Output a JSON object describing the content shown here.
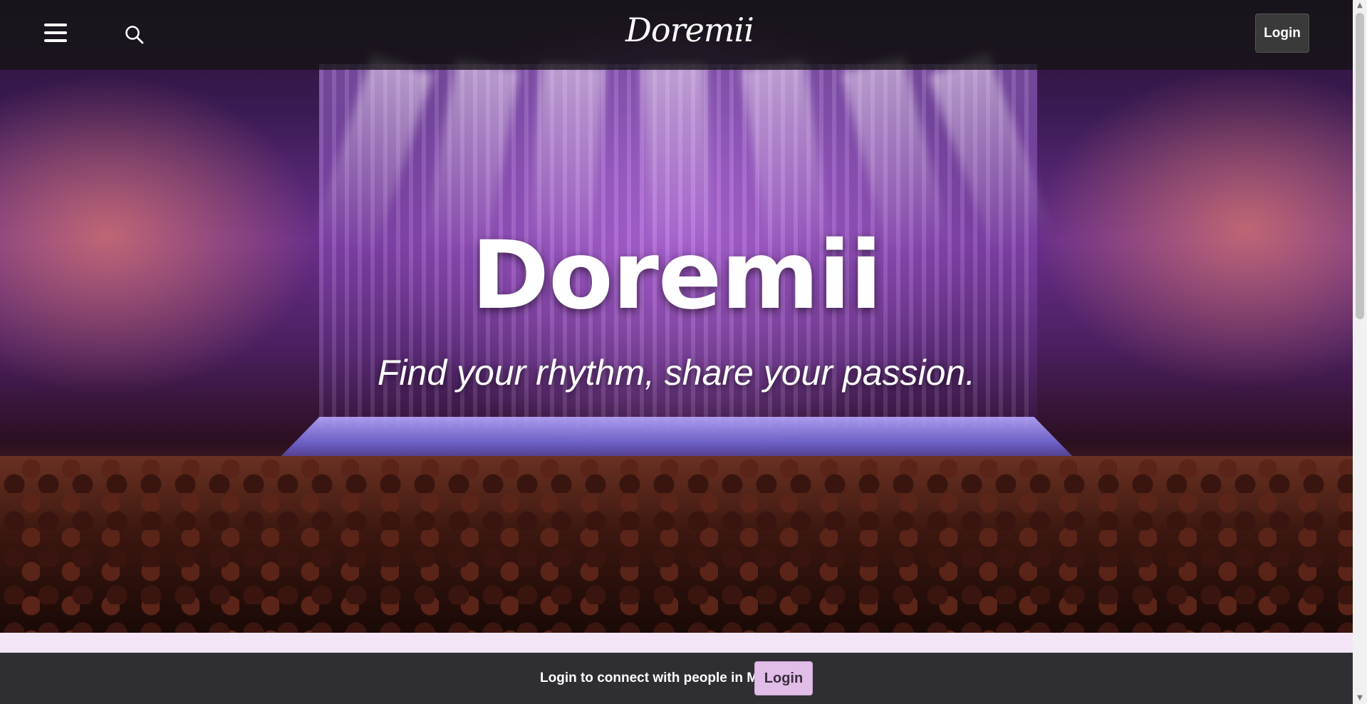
{
  "header": {
    "logo_text": "Doremii",
    "login_label": "Login"
  },
  "hero": {
    "title": "Doremii",
    "subtitle": "Find your rhythm, share your passion."
  },
  "banner": {
    "text": "Login to connect with people in MSN",
    "login_label": "Login"
  },
  "colors": {
    "header_bg": "#141414",
    "banner_bg": "#2f2f33",
    "accent_lavender": "#e1bee7",
    "strip_bg": "#f3e5f5"
  },
  "icons": {
    "menu": "hamburger-menu-icon",
    "search": "search-icon",
    "scroll_up": "scroll-up-arrow-icon",
    "scroll_down": "scroll-down-arrow-icon"
  }
}
